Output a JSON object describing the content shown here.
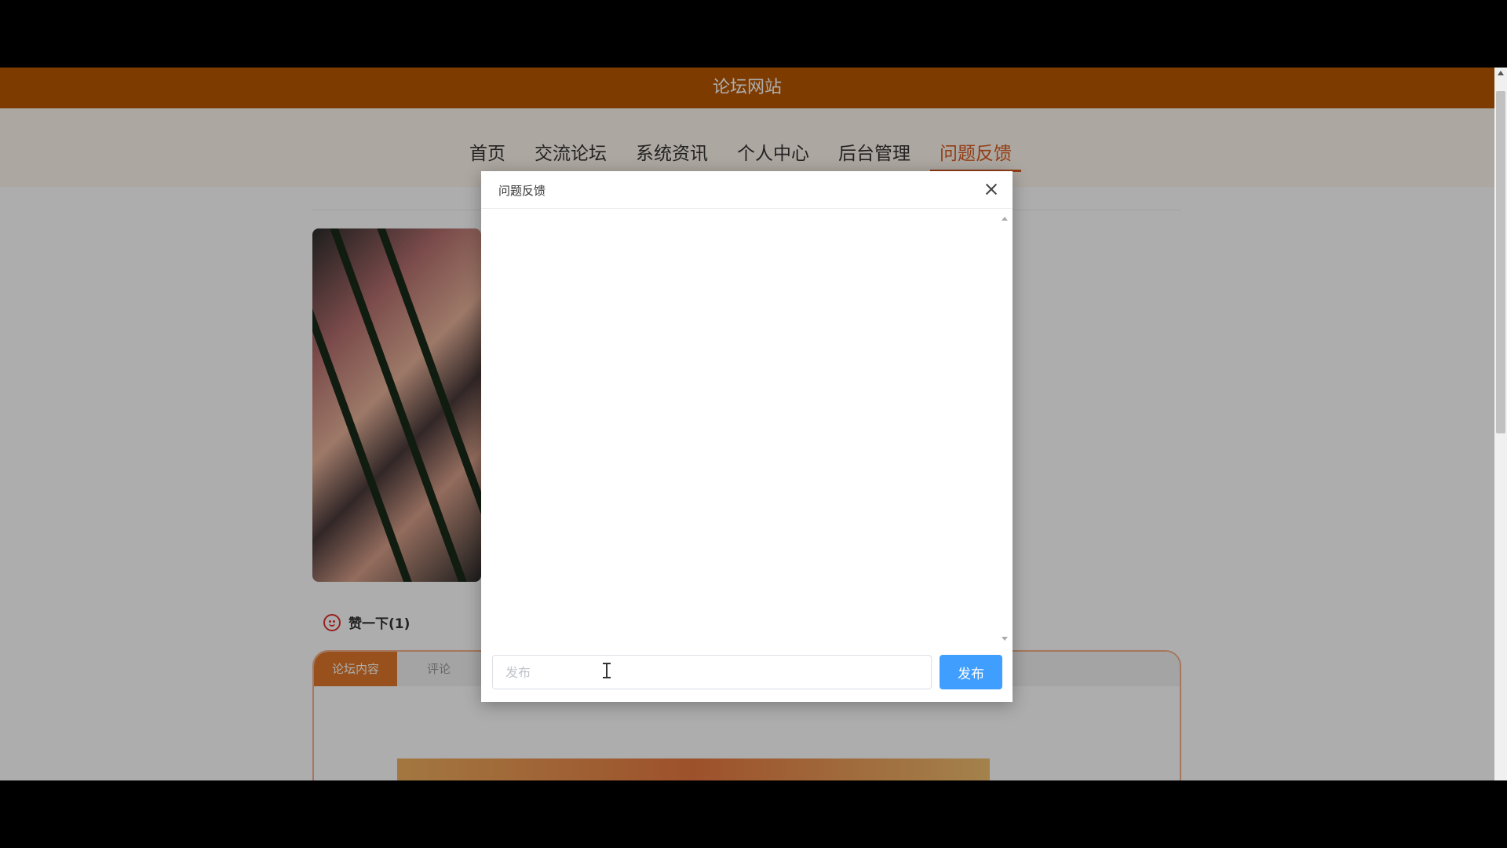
{
  "site": {
    "title": "论坛网站"
  },
  "nav": {
    "items": [
      {
        "label": "首页"
      },
      {
        "label": "交流论坛"
      },
      {
        "label": "系统资讯"
      },
      {
        "label": "个人中心"
      },
      {
        "label": "后台管理"
      },
      {
        "label": "问题反馈",
        "active": true
      }
    ]
  },
  "post": {
    "like_label": "赞一下(1)",
    "tabs": [
      {
        "label": "论坛内容",
        "active": true
      },
      {
        "label": "评论"
      }
    ]
  },
  "modal": {
    "title": "问题反馈",
    "input_placeholder": "发布",
    "submit_label": "发布"
  },
  "colors": {
    "header": "#b85700",
    "nav_active": "#d85a1e",
    "primary_button": "#409eff",
    "tab_active": "#e0782a"
  }
}
